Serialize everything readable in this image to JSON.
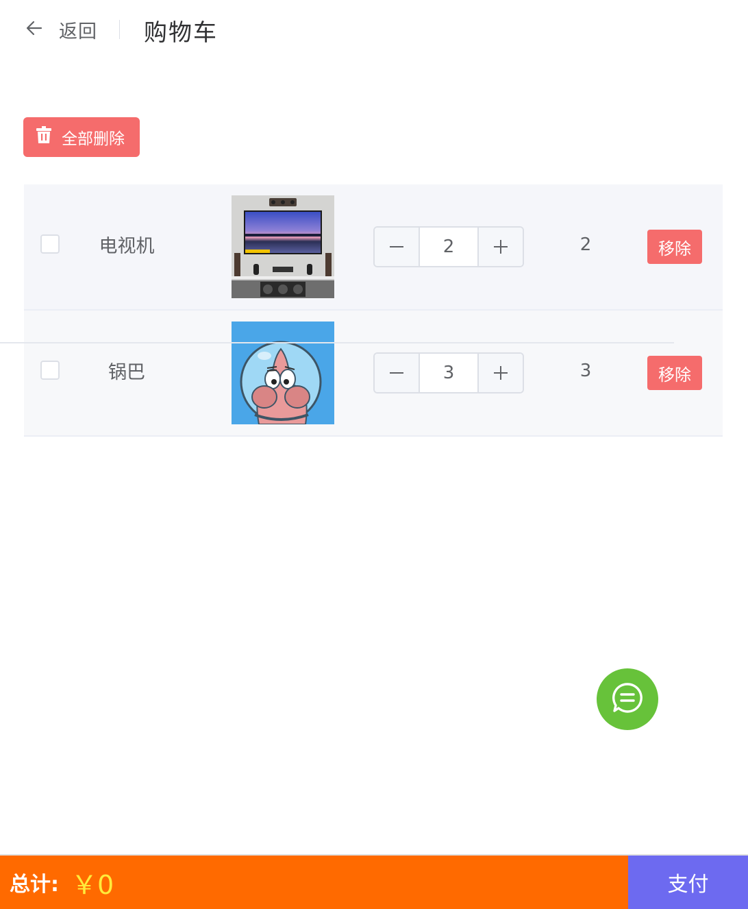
{
  "header": {
    "back_label": "返回",
    "title": "购物车"
  },
  "toolbar": {
    "delete_all_label": "全部删除"
  },
  "items": [
    {
      "name": "电视机",
      "image": "tv-product-image",
      "quantity": "2",
      "subtotal": "2",
      "remove_label": "移除"
    },
    {
      "name": "锅巴",
      "image": "patrick-star-image",
      "quantity": "3",
      "subtotal": "3",
      "remove_label": "移除"
    }
  ],
  "footer": {
    "total_label": "总计:",
    "total_value": "￥0",
    "pay_label": "支付"
  },
  "colors": {
    "danger": "#f56c6c",
    "total_bar": "#ff6a00",
    "pay": "#6d6af0",
    "chat": "#67c23a",
    "total_value": "#ffeb3b"
  }
}
